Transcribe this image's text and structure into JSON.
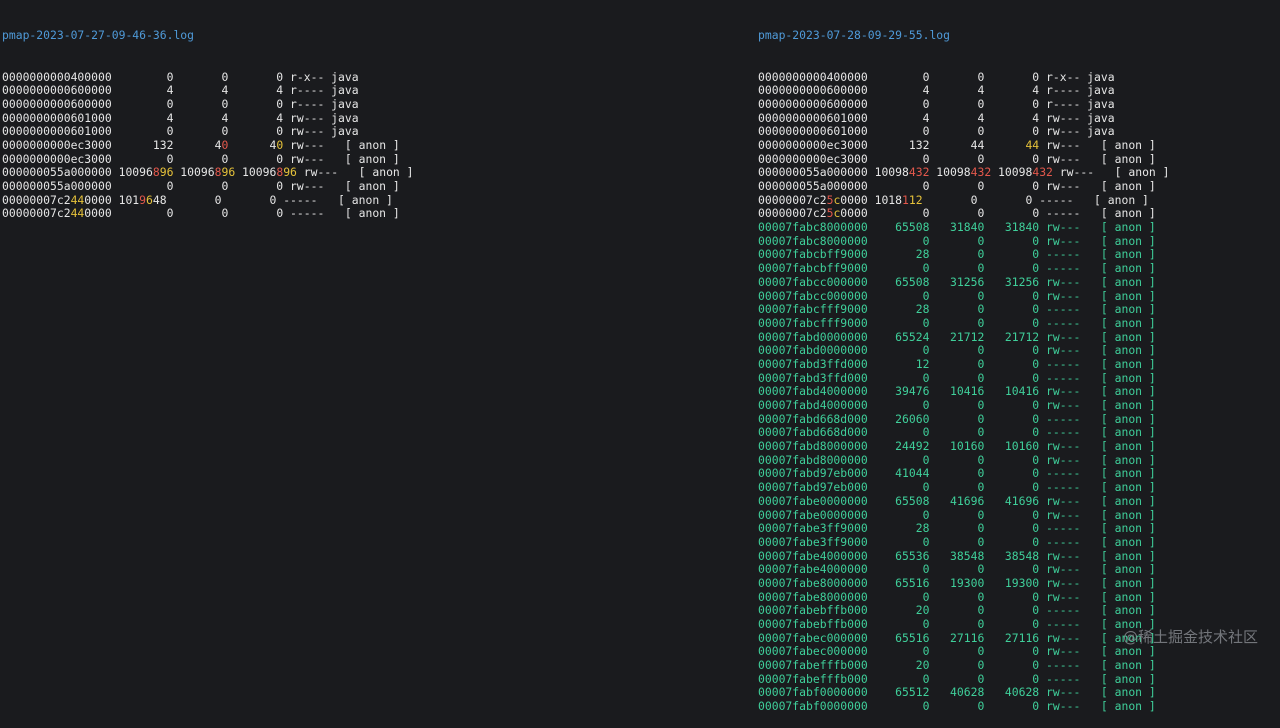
{
  "colors": {
    "background": "#1a1b1e",
    "text": "#e6e6e6",
    "title": "#4f9ad8",
    "red": "#e3584c",
    "yellow": "#e6c23a",
    "cyan": "#3fcf9a"
  },
  "left": {
    "title": "pmap-2023-07-27-09-46-36.log",
    "lines": [
      [
        [
          "w",
          "0000000000400000        0       0       0 r-x-- java"
        ]
      ],
      [
        [
          "w",
          "0000000000600000        4       4       4 r---- java"
        ]
      ],
      [
        [
          "w",
          "0000000000600000        0       0       0 r---- java"
        ]
      ],
      [
        [
          "w",
          "0000000000601000        4       4       4 rw--- java"
        ]
      ],
      [
        [
          "w",
          "0000000000601000        0       0       0 rw--- java"
        ]
      ],
      [
        [
          "w",
          "0000000000ec3000      132      4"
        ],
        [
          "r",
          "0"
        ],
        [
          "w",
          "      4"
        ],
        [
          "y",
          "0"
        ],
        [
          "w",
          " rw---   [ anon ]"
        ]
      ],
      [
        [
          "w",
          "0000000000ec3000        0       0       0 rw---   [ anon ]"
        ]
      ],
      [
        [
          "w",
          "000000055a000000 10096"
        ],
        [
          "r",
          "8"
        ],
        [
          "y",
          "96"
        ],
        [
          "w",
          " 10096"
        ],
        [
          "r",
          "8"
        ],
        [
          "y",
          "96"
        ],
        [
          "w",
          " 10096"
        ],
        [
          "r",
          "8"
        ],
        [
          "y",
          "96"
        ],
        [
          "w",
          " rw---   [ anon ]"
        ]
      ],
      [
        [
          "w",
          "000000055a000000        0       0       0 rw---   [ anon ]"
        ]
      ],
      [
        [
          "w",
          "00000007c2"
        ],
        [
          "y",
          "44"
        ],
        [
          "w",
          "0000 101"
        ],
        [
          "r",
          "9"
        ],
        [
          "y",
          "6"
        ],
        [
          "w",
          "48       0       0 -----   [ anon ]"
        ]
      ],
      [
        [
          "w",
          "00000007c2"
        ],
        [
          "y",
          "44"
        ],
        [
          "w",
          "0000        0       0       0 -----   [ anon ]"
        ]
      ]
    ]
  },
  "right": {
    "title": "pmap-2023-07-28-09-29-55.log",
    "lines": [
      [
        [
          "w",
          "0000000000400000        0       0       0 r-x-- java"
        ]
      ],
      [
        [
          "w",
          "0000000000600000        4       4       4 r---- java"
        ]
      ],
      [
        [
          "w",
          "0000000000600000        0       0       0 r---- java"
        ]
      ],
      [
        [
          "w",
          "0000000000601000        4       4       4 rw--- java"
        ]
      ],
      [
        [
          "w",
          "0000000000601000        0       0       0 rw--- java"
        ]
      ],
      [
        [
          "w",
          "0000000000ec3000      132      44      "
        ],
        [
          "y",
          "44"
        ],
        [
          "w",
          " rw---   [ anon ]"
        ]
      ],
      [
        [
          "w",
          "0000000000ec3000        0       0       0 rw---   [ anon ]"
        ]
      ],
      [
        [
          "w",
          "000000055a000000 10098"
        ],
        [
          "r",
          "432"
        ],
        [
          "w",
          " 10098"
        ],
        [
          "r",
          "432"
        ],
        [
          "w",
          " 10098"
        ],
        [
          "r",
          "432"
        ],
        [
          "w",
          " rw---   [ anon ]"
        ]
      ],
      [
        [
          "w",
          "000000055a000000        0       0       0 rw---   [ anon ]"
        ]
      ],
      [
        [
          "w",
          "00000007c2"
        ],
        [
          "r",
          "5"
        ],
        [
          "y",
          "c"
        ],
        [
          "w",
          "0000 1018"
        ],
        [
          "r",
          "1"
        ],
        [
          "y",
          "12"
        ],
        [
          "w",
          "       0       0 -----   [ anon ]"
        ]
      ],
      [
        [
          "w",
          "00000007c2"
        ],
        [
          "r",
          "5"
        ],
        [
          "y",
          "c"
        ],
        [
          "w",
          "0000        0       0       0 -----   [ anon ]"
        ]
      ],
      [
        [
          "c",
          "00007fabc8000000    65508   31840   31840 rw---   [ anon ]"
        ]
      ],
      [
        [
          "c",
          "00007fabc8000000        0       0       0 rw---   [ anon ]"
        ]
      ],
      [
        [
          "c",
          "00007fabcbff9000       28       0       0 -----   [ anon ]"
        ]
      ],
      [
        [
          "c",
          "00007fabcbff9000        0       0       0 -----   [ anon ]"
        ]
      ],
      [
        [
          "c",
          "00007fabcc000000    65508   31256   31256 rw---   [ anon ]"
        ]
      ],
      [
        [
          "c",
          "00007fabcc000000        0       0       0 rw---   [ anon ]"
        ]
      ],
      [
        [
          "c",
          "00007fabcfff9000       28       0       0 -----   [ anon ]"
        ]
      ],
      [
        [
          "c",
          "00007fabcfff9000        0       0       0 -----   [ anon ]"
        ]
      ],
      [
        [
          "c",
          "00007fabd0000000    65524   21712   21712 rw---   [ anon ]"
        ]
      ],
      [
        [
          "c",
          "00007fabd0000000        0       0       0 rw---   [ anon ]"
        ]
      ],
      [
        [
          "c",
          "00007fabd3ffd000       12       0       0 -----   [ anon ]"
        ]
      ],
      [
        [
          "c",
          "00007fabd3ffd000        0       0       0 -----   [ anon ]"
        ]
      ],
      [
        [
          "c",
          "00007fabd4000000    39476   10416   10416 rw---   [ anon ]"
        ]
      ],
      [
        [
          "c",
          "00007fabd4000000        0       0       0 rw---   [ anon ]"
        ]
      ],
      [
        [
          "c",
          "00007fabd668d000    26060       0       0 -----   [ anon ]"
        ]
      ],
      [
        [
          "c",
          "00007fabd668d000        0       0       0 -----   [ anon ]"
        ]
      ],
      [
        [
          "c",
          "00007fabd8000000    24492   10160   10160 rw---   [ anon ]"
        ]
      ],
      [
        [
          "c",
          "00007fabd8000000        0       0       0 rw---   [ anon ]"
        ]
      ],
      [
        [
          "c",
          "00007fabd97eb000    41044       0       0 -----   [ anon ]"
        ]
      ],
      [
        [
          "c",
          "00007fabd97eb000        0       0       0 -----   [ anon ]"
        ]
      ],
      [
        [
          "c",
          "00007fabe0000000    65508   41696   41696 rw---   [ anon ]"
        ]
      ],
      [
        [
          "c",
          "00007fabe0000000        0       0       0 rw---   [ anon ]"
        ]
      ],
      [
        [
          "c",
          "00007fabe3ff9000       28       0       0 -----   [ anon ]"
        ]
      ],
      [
        [
          "c",
          "00007fabe3ff9000        0       0       0 -----   [ anon ]"
        ]
      ],
      [
        [
          "c",
          "00007fabe4000000    65536   38548   38548 rw---   [ anon ]"
        ]
      ],
      [
        [
          "c",
          "00007fabe4000000        0       0       0 rw---   [ anon ]"
        ]
      ],
      [
        [
          "c",
          "00007fabe8000000    65516   19300   19300 rw---   [ anon ]"
        ]
      ],
      [
        [
          "c",
          "00007fabe8000000        0       0       0 rw---   [ anon ]"
        ]
      ],
      [
        [
          "c",
          "00007fabebffb000       20       0       0 -----   [ anon ]"
        ]
      ],
      [
        [
          "c",
          "00007fabebffb000        0       0       0 -----   [ anon ]"
        ]
      ],
      [
        [
          "c",
          "00007fabec000000    65516   27116   27116 rw---   [ anon ]"
        ]
      ],
      [
        [
          "c",
          "00007fabec000000        0       0       0 rw---   [ anon ]"
        ]
      ],
      [
        [
          "c",
          "00007fabefffb000       20       0       0 -----   [ anon ]"
        ]
      ],
      [
        [
          "c",
          "00007fabefffb000        0       0       0 -----   [ anon ]"
        ]
      ],
      [
        [
          "c",
          "00007fabf0000000    65512   40628   40628 rw---   [ anon ]"
        ]
      ],
      [
        [
          "c",
          "00007fabf0000000        0       0       0 rw---   [ anon ]"
        ]
      ]
    ]
  },
  "watermark": "@稀土掘金技术社区"
}
